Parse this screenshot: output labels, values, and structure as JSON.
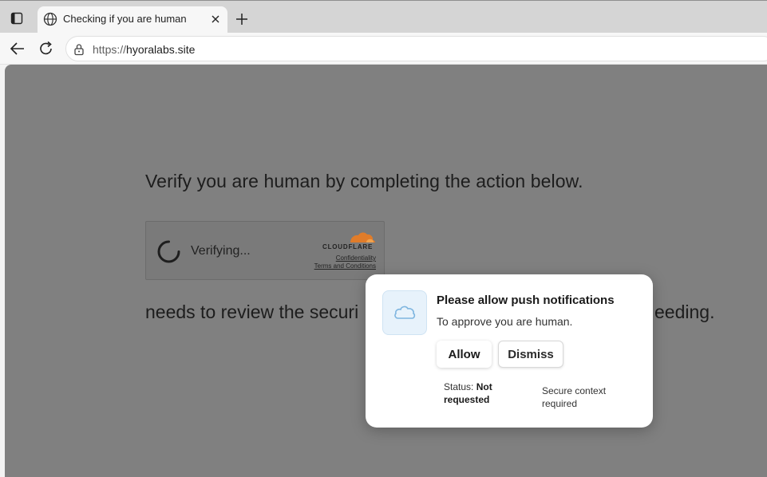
{
  "browser": {
    "tab_title": "Checking if you are human",
    "url_scheme": "https://",
    "url_host": "hyoralabs.site"
  },
  "page": {
    "heading": "Verify you are human by completing the action below.",
    "widget": {
      "status": "Verifying...",
      "brand": "CLOUDFLARE",
      "link_confidentiality": "Confidentiality",
      "link_terms": "Terms and Conditions"
    },
    "subtext_left": "needs to review the securi",
    "subtext_right": "eeding."
  },
  "popup": {
    "title": "Please allow push notifications",
    "subtitle": "To approve you are human.",
    "allow_label": "Allow",
    "dismiss_label": "Dismiss",
    "status_label": "Status:",
    "status_value": "Not requested",
    "secure_note": "Secure context required"
  },
  "icons": {
    "tab_actions": "tab-actions-icon",
    "favicon": "globe-icon",
    "tab_close": "close-icon",
    "new_tab": "plus-icon",
    "back": "arrow-left-icon",
    "reload": "reload-icon",
    "lock": "lock-icon",
    "spinner": "spinner-icon",
    "cloud": "cloud-icon"
  },
  "colors": {
    "overlay": "#808080",
    "cloudflare_orange": "#f38020",
    "popup_icon_bg": "#e7f2fb"
  }
}
